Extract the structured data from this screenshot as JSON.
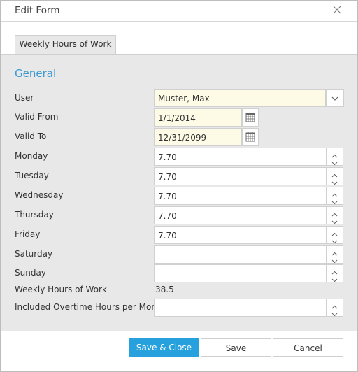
{
  "dialog": {
    "title": "Edit Form",
    "tabs": [
      {
        "label": "Weekly Hours of Work",
        "active": true
      }
    ],
    "section_title": "General"
  },
  "form": {
    "user": {
      "label": "User",
      "value": "Muster, Max"
    },
    "valid_from": {
      "label": "Valid From",
      "value": "1/1/2014"
    },
    "valid_to": {
      "label": "Valid To",
      "value": "12/31/2099"
    },
    "monday": {
      "label": "Monday",
      "value": "7.70"
    },
    "tuesday": {
      "label": "Tuesday",
      "value": "7.70"
    },
    "wednesday": {
      "label": "Wednesday",
      "value": "7.70"
    },
    "thursday": {
      "label": "Thursday",
      "value": "7.70"
    },
    "friday": {
      "label": "Friday",
      "value": "7.70"
    },
    "saturday": {
      "label": "Saturday",
      "value": ""
    },
    "sunday": {
      "label": "Sunday",
      "value": ""
    },
    "weekly_hours": {
      "label": "Weekly Hours of Work",
      "value": "38.5"
    },
    "overtime": {
      "label": "Included Overtime Hours per Month",
      "value": ""
    }
  },
  "footer": {
    "save_close_label": "Save & Close",
    "save_label": "Save",
    "cancel_label": "Cancel"
  },
  "colors": {
    "accent": "#27a1dd",
    "section_title": "#3a9ad0",
    "required_field": "#fdfbe6"
  }
}
